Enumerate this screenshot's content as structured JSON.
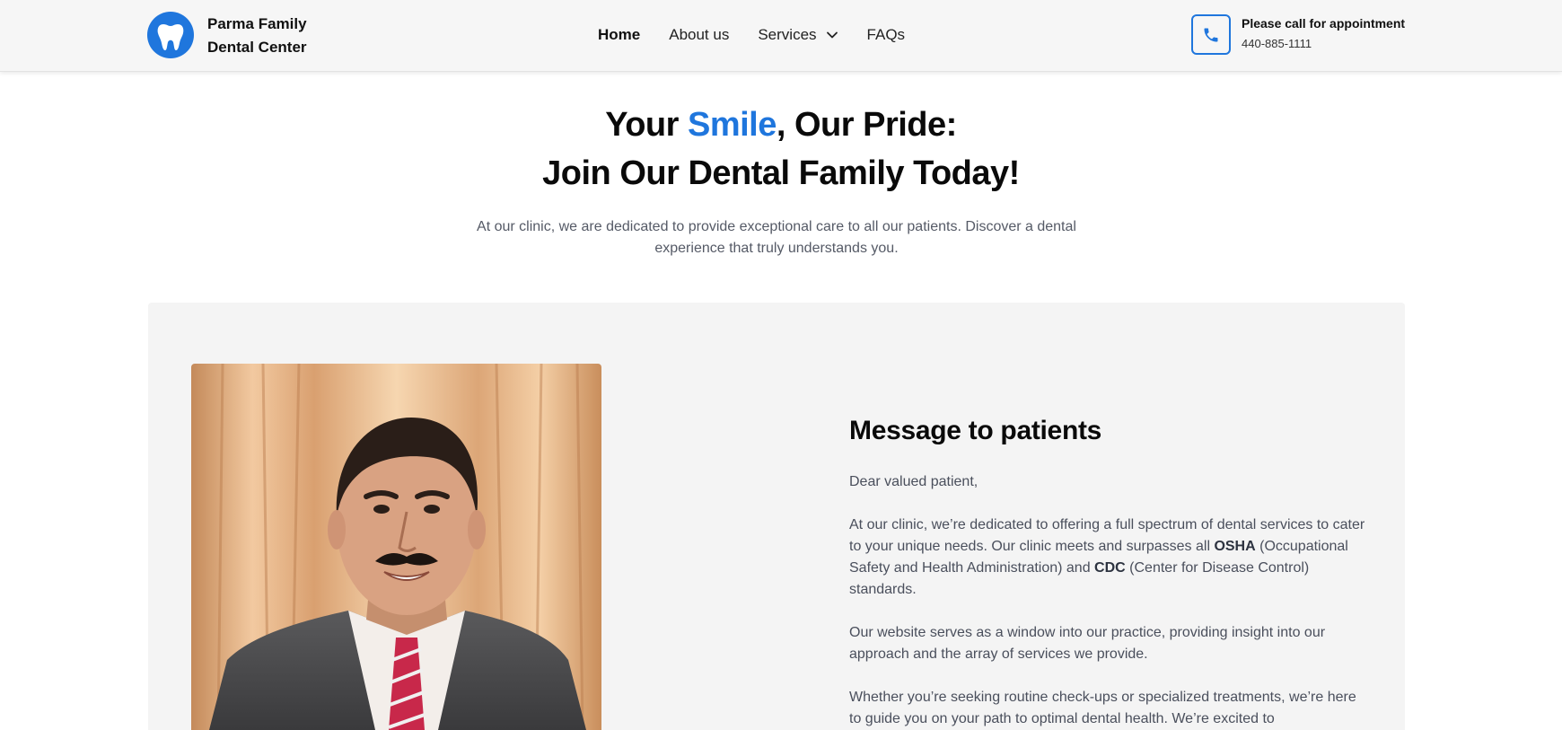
{
  "header": {
    "brand_line1": "Parma Family",
    "brand_line2": "Dental Center",
    "nav": [
      {
        "label": "Home",
        "active": true
      },
      {
        "label": "About us",
        "active": false
      },
      {
        "label": "Services",
        "active": false,
        "has_dropdown": true
      },
      {
        "label": "FAQs",
        "active": false
      }
    ],
    "appointment_label": "Please call for appointment",
    "phone_number": "440-885-1111"
  },
  "hero": {
    "title_part1": "Your ",
    "title_accent": "Smile",
    "title_part2": ", Our Pride:",
    "title_line2": "Join Our Dental Family Today!",
    "subtitle": "At our clinic, we are dedicated to provide exceptional care to all our patients. Discover a dental experience that truly understands you."
  },
  "message": {
    "title": "Message to patients",
    "greeting": "Dear valued patient,",
    "p1_a": "At our clinic, we’re dedicated to offering a full spectrum of dental services to cater to your unique needs. Our clinic meets and surpasses all ",
    "p1_osha": "OSHA",
    "p1_b": " (Occupational Safety and Health Administration) and ",
    "p1_cdc": "CDC",
    "p1_c": " (Center for Disease Control) standards.",
    "p2": "Our website serves as a window into our practice, providing insight into our approach and the array of services we provide.",
    "p3": "Whether you’re seeking routine check-ups or specialized treatments, we’re here to guide you on your path to optimal dental health. We’re excited to"
  },
  "colors": {
    "accent": "#1f76dd",
    "header_bg": "#f6f6f6",
    "panel_bg": "#f4f4f4",
    "body_text": "#4a4f5c"
  },
  "icons": {
    "logo": "tooth-icon",
    "phone": "phone-icon",
    "dropdown": "chevron-down-icon"
  }
}
